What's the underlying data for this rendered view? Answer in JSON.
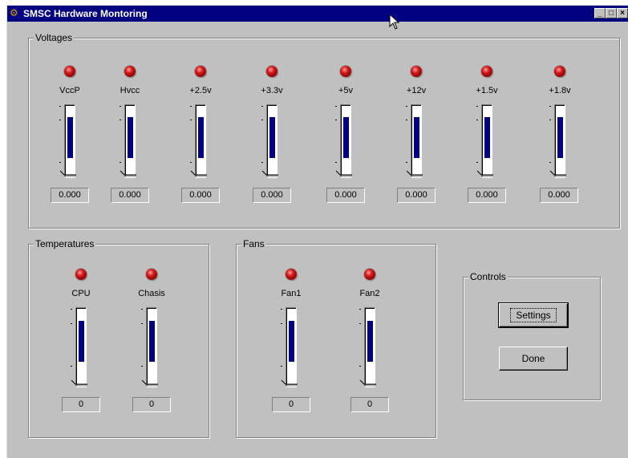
{
  "window": {
    "title": "SMSC Hardware Montoring"
  },
  "voltages": {
    "label": "Voltages",
    "channels": [
      {
        "name": "VccP",
        "value": "0.000",
        "level": 0.72
      },
      {
        "name": "Hvcc",
        "value": "0.000",
        "level": 0.72
      },
      {
        "name": "+2.5v",
        "value": "0.000",
        "level": 0.72
      },
      {
        "name": "+3.3v",
        "value": "0.000",
        "level": 0.72
      },
      {
        "name": "+5v",
        "value": "0.000",
        "level": 0.72
      },
      {
        "name": "+12v",
        "value": "0.000",
        "level": 0.72
      },
      {
        "name": "+1.5v",
        "value": "0.000",
        "level": 0.72
      },
      {
        "name": "+1.8v",
        "value": "0.000",
        "level": 0.72
      }
    ]
  },
  "temperatures": {
    "label": "Temperatures",
    "channels": [
      {
        "name": "CPU",
        "value": "0",
        "level": 0.65
      },
      {
        "name": "Chasis",
        "value": "0",
        "level": 0.65
      }
    ]
  },
  "fans": {
    "label": "Fans",
    "channels": [
      {
        "name": "Fan1",
        "value": "0",
        "level": 0.65
      },
      {
        "name": "Fan2",
        "value": "0",
        "level": 0.65
      }
    ]
  },
  "controls": {
    "label": "Controls",
    "settings_label": "Settings",
    "done_label": "Done"
  },
  "icons": {
    "app": "chip-icon",
    "minimize": "minimize-icon",
    "maximize": "maximize-icon",
    "close": "close-icon",
    "cursor": "mouse-pointer-icon"
  },
  "colors": {
    "titlebar": "#000080",
    "meter_fill": "#000080",
    "led": "#d01818",
    "window_bg": "#c0c0c0"
  }
}
